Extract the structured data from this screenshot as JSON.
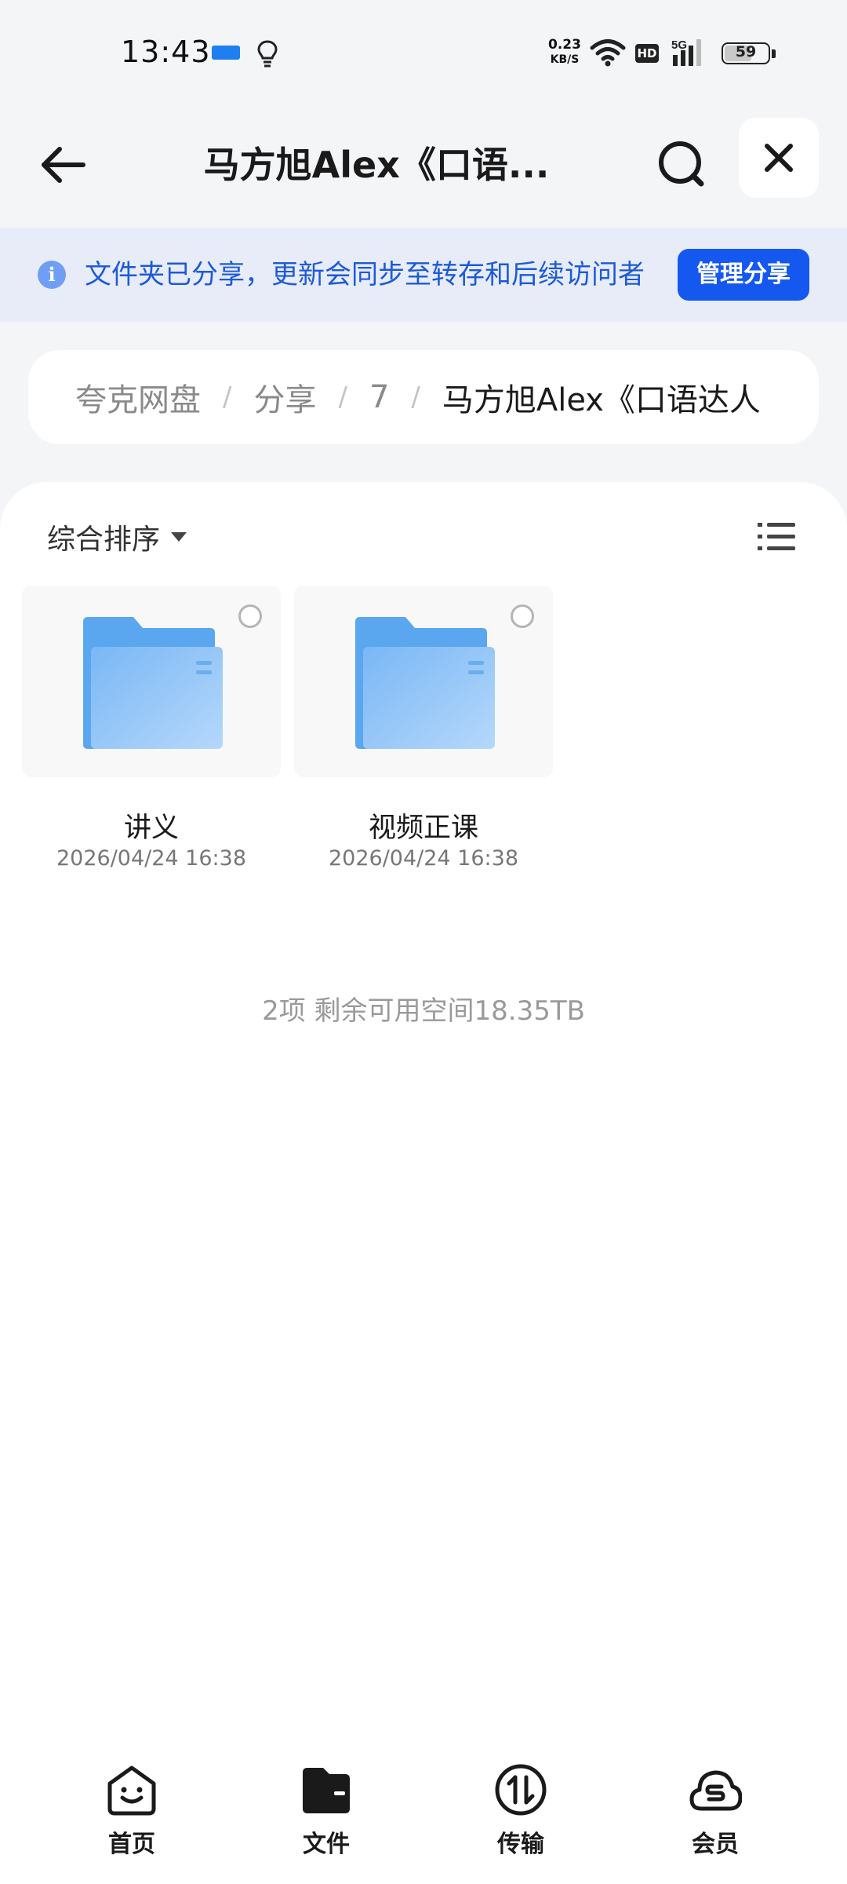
{
  "status_bar": {
    "time": "13:43",
    "net_speed_value": "0.23",
    "net_speed_unit": "KB/S",
    "hd_label": "HD",
    "network_label": "5G",
    "battery_level": "59",
    "battery_fraction": 0.59,
    "icons": [
      "app-notification-icon",
      "bulb-icon",
      "wifi-icon",
      "signal-icon",
      "battery-icon"
    ]
  },
  "header": {
    "title": "马方旭Alex《口语...",
    "icons": [
      "back-arrow-icon",
      "search-icon",
      "close-icon"
    ]
  },
  "share_banner": {
    "info_glyph": "i",
    "text": "文件夹已分享，更新会同步至转存和后续访问者",
    "button_label": "管理分享",
    "accent": "#1558f0"
  },
  "breadcrumb": {
    "items": [
      "夸克网盘",
      "分享",
      "7",
      "马方旭Alex《口语达人"
    ],
    "separator": "/"
  },
  "toolbar": {
    "sort_label": "综合排序",
    "icons": [
      "sort-caret-icon",
      "list-view-icon"
    ]
  },
  "files": [
    {
      "name": "讲义",
      "date": "2026/04/24 16:38",
      "type": "folder"
    },
    {
      "name": "视频正课",
      "date": "2026/04/24 16:38",
      "type": "folder"
    }
  ],
  "summary": "2项 剩余可用空间18.35TB",
  "bottom_nav": {
    "items": [
      {
        "label": "首页",
        "icon": "home-face-icon"
      },
      {
        "label": "文件",
        "icon": "folder-wallet-icon"
      },
      {
        "label": "传输",
        "icon": "transfer-icon"
      },
      {
        "label": "会员",
        "icon": "member-cloud-icon"
      }
    ],
    "active_index": 1
  }
}
